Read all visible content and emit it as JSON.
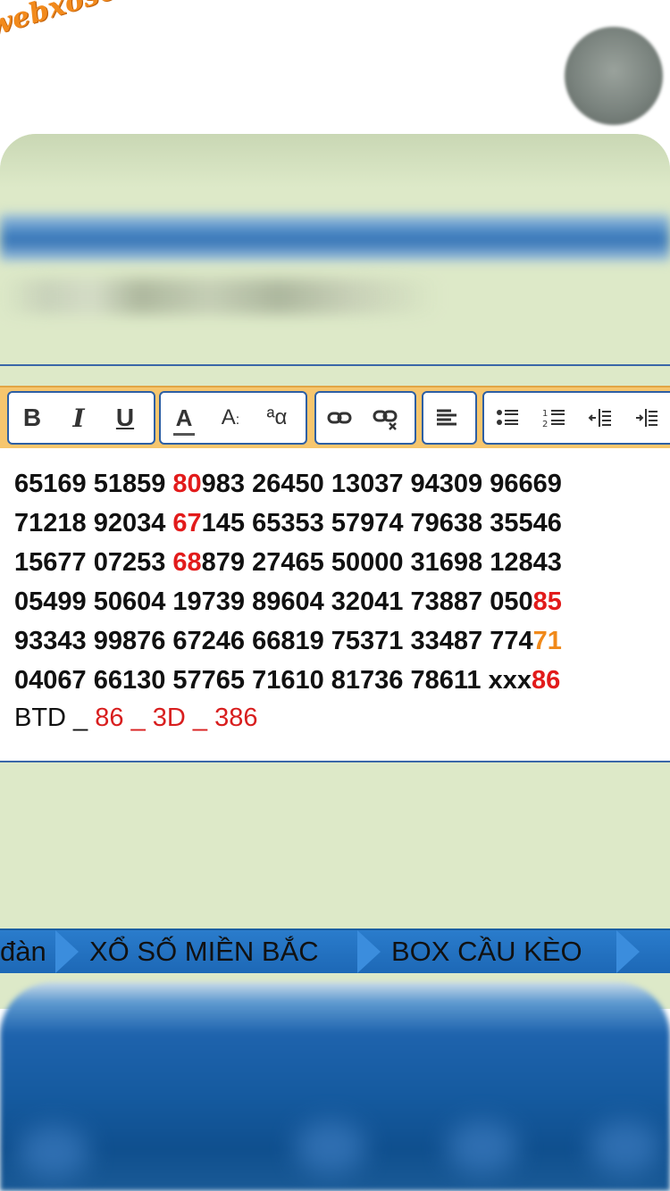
{
  "header": {
    "logo_text": "webxoso.net"
  },
  "toolbar": {
    "buttons": [
      "bold-icon",
      "italic-icon",
      "underline-icon",
      "font-color-icon",
      "font-size-icon",
      "font-family-icon",
      "link-icon",
      "unlink-icon",
      "align-left-icon",
      "bullet-list-icon",
      "numbered-list-icon",
      "outdent-icon",
      "indent-icon"
    ],
    "bold_label": "B",
    "italic_label": "I",
    "underline_label": "U",
    "font_color_label": "A",
    "font_size_label": "A",
    "font_family_label": "ªα"
  },
  "editor": {
    "rows": [
      [
        {
          "t": "65169 51859 "
        },
        {
          "t": "80",
          "c": "red"
        },
        {
          "t": "983 26450 13037 94309 96669"
        }
      ],
      [
        {
          "t": "71218 92034 "
        },
        {
          "t": "67",
          "c": "red"
        },
        {
          "t": "145 65353 57974 79638 35546"
        }
      ],
      [
        {
          "t": "15677 07253 "
        },
        {
          "t": "68",
          "c": "red"
        },
        {
          "t": "879 27465 50000 31698 12843"
        }
      ],
      [
        {
          "t": "05499 50604 19739 89604 32041 73887 050"
        },
        {
          "t": "85",
          "c": "red"
        }
      ],
      [
        {
          "t": "93343 99876 67246 66819 75371 33487 774"
        },
        {
          "t": "71",
          "c": "orange"
        }
      ],
      [
        {
          "t": "04067 66130 57765 71610 81736 78611 xxx"
        },
        {
          "t": "86",
          "c": "red"
        }
      ]
    ],
    "btd_prefix": "BTD _ ",
    "btd_value": "86 _ 3D _ 386"
  },
  "nav": {
    "items": [
      "đàn",
      "XỔ SỐ MIỀN BẮC",
      "BOX CẦU KÈO"
    ]
  }
}
